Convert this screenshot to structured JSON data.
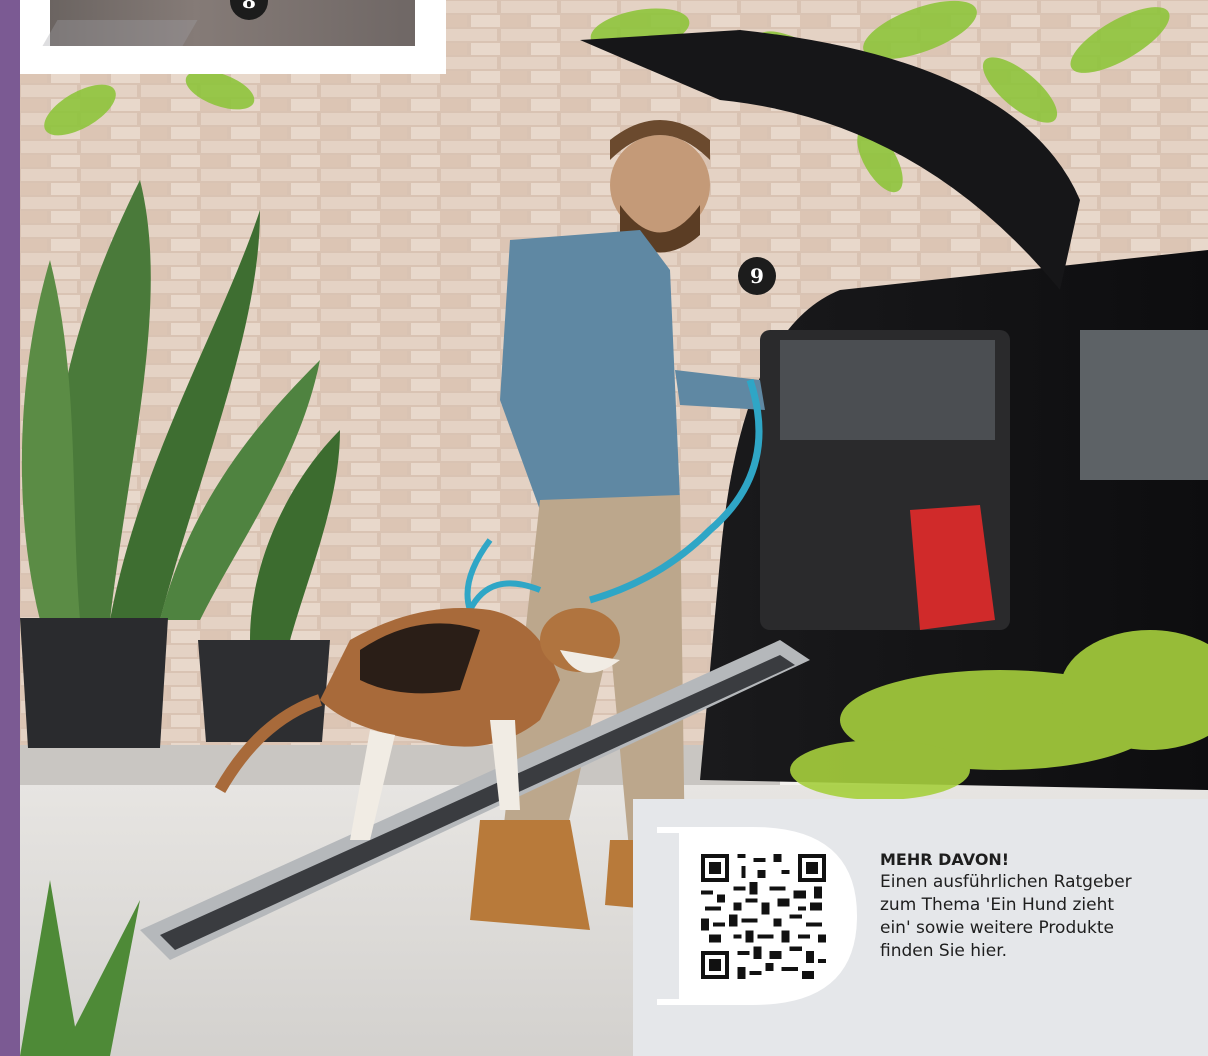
{
  "badges": {
    "eight": "8",
    "nine": "9"
  },
  "info": {
    "heading": "MEHR DAVON!",
    "lines": [
      "Einen ausführlichen Ratgeber",
      "zum Thema 'Ein Hund zieht",
      "ein' sowie weitere Produkte",
      "finden Sie hier."
    ]
  },
  "colors": {
    "accent_strip": "#7b5a93",
    "info_box": "#e5e7ea",
    "badge": "#1c1c1c"
  },
  "icons": {
    "qr": "qr-code-icon",
    "decorative_letter": "letter-d-icon"
  }
}
